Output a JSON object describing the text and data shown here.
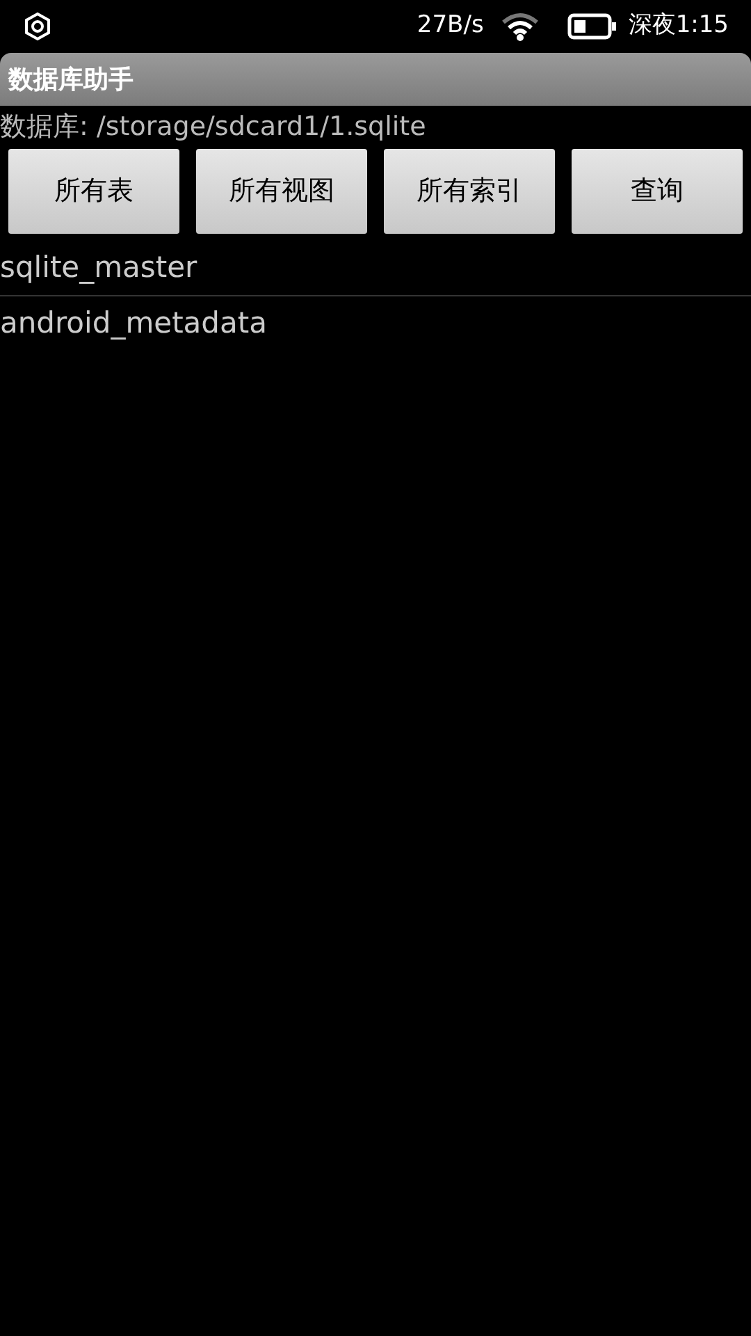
{
  "status_bar": {
    "speed": "27B/s",
    "time": "深夜1:15"
  },
  "title_bar": {
    "title": "数据库助手"
  },
  "database_path": "数据库: /storage/sdcard1/1.sqlite",
  "buttons": [
    "所有表",
    "所有视图",
    "所有索引",
    "查询"
  ],
  "tables": [
    "sqlite_master",
    "android_metadata"
  ]
}
